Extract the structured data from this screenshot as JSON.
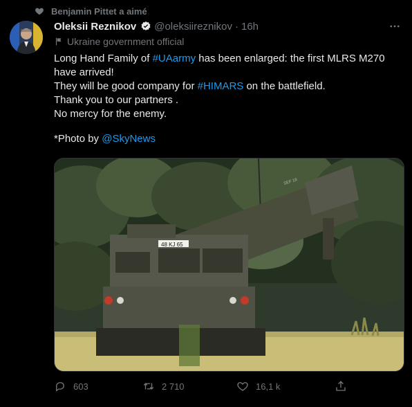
{
  "social_context": {
    "text": "Benjamin Pittet a aimé",
    "icon": "heart-icon"
  },
  "author": {
    "name": "Oleksii Reznikov",
    "handle": "@oleksiireznikov",
    "separator": "·",
    "time": "16h",
    "label": "Ukraine government official",
    "verified_icon": "verified-badge-icon"
  },
  "tweet": {
    "line1_prefix": "Long Hand Family of ",
    "line1_hashtag": "#UAarmy",
    "line1_suffix": " has been enlarged: the first MLRS M270",
    "line2": "have arrived!",
    "line3_prefix": "They will be good company for ",
    "line3_hashtag": "#HIMARS",
    "line3_suffix": " on the battlefield.",
    "line4": "Thank you to our partners .",
    "line5": "No mercy for the enemy.",
    "credit_prefix": "*Photo by ",
    "credit_mention": "@SkyNews"
  },
  "media": {
    "vehicle_marking": "48 KJ 65",
    "pod_marking": "SEF 18"
  },
  "actions": {
    "reply_count": "603",
    "retweet_count": "2 710",
    "like_count": "16,1 k",
    "share_label": ""
  },
  "colors": {
    "background": "#000000",
    "text": "#e7e9ea",
    "muted": "#71767b",
    "link": "#1d9bf0"
  }
}
